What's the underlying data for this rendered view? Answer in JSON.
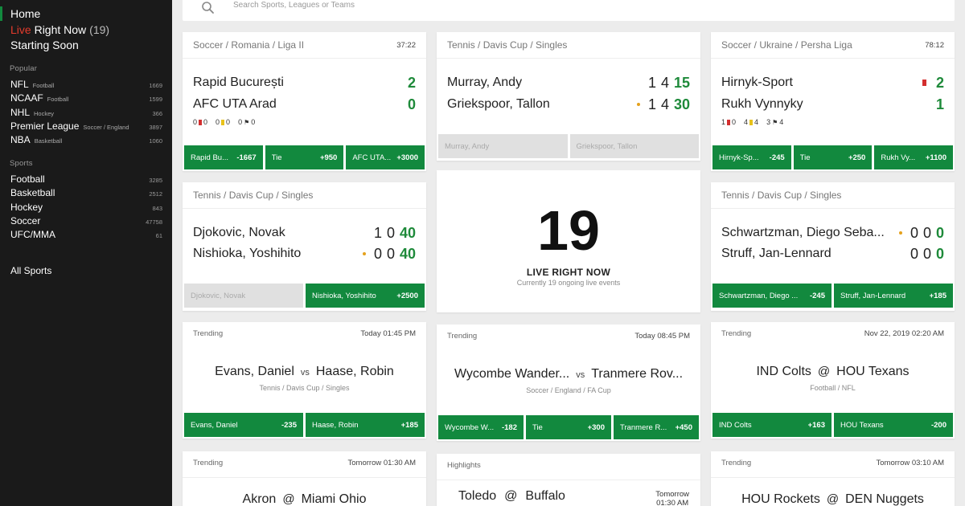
{
  "search": {
    "placeholder": "Search Sports, Leagues or Teams"
  },
  "nav": {
    "home": "Home",
    "live_prefix": "Live",
    "live_rest": "Right Now",
    "live_count": "(19)",
    "starting_soon": "Starting Soon",
    "popular_title": "Popular",
    "popular": [
      {
        "label": "NFL",
        "sub": "Football",
        "count": "1669"
      },
      {
        "label": "NCAAF",
        "sub": "Football",
        "count": "1599"
      },
      {
        "label": "NHL",
        "sub": "Hockey",
        "count": "366"
      },
      {
        "label": "Premier League",
        "sub": "Soccer / England",
        "count": "3897"
      },
      {
        "label": "NBA",
        "sub": "Basketball",
        "count": "1060"
      }
    ],
    "sports_title": "Sports",
    "sports": [
      {
        "label": "Football",
        "count": "3285"
      },
      {
        "label": "Basketball",
        "count": "2512"
      },
      {
        "label": "Hockey",
        "count": "843"
      },
      {
        "label": "Soccer",
        "count": "47758"
      },
      {
        "label": "UFC/MMA",
        "count": "61"
      }
    ],
    "all_sports": "All Sports"
  },
  "live_cards": {
    "c1": {
      "crumb": "Soccer / Romania / Liga II",
      "time": "37:22",
      "home": "Rapid București",
      "away": "AFC UTA Arad",
      "home_score": "2",
      "away_score": "0",
      "stats": {
        "red": "0",
        "red2": "0",
        "yellow": "0",
        "yellow2": "0",
        "corners": "0",
        "corners2": "0"
      },
      "btns": [
        {
          "label": "Rapid Bu...",
          "odds": "-1667"
        },
        {
          "label": "Tie",
          "odds": "+950"
        },
        {
          "label": "AFC UTA...",
          "odds": "+3000"
        }
      ]
    },
    "c2": {
      "crumb": "Tennis / Davis Cup / Singles",
      "home": "Murray, Andy",
      "away": "Griekspoor, Tallon",
      "home_s1": "1",
      "home_s2": "4",
      "home_s3": "15",
      "away_s1": "1",
      "away_s2": "4",
      "away_s3": "30",
      "btns": [
        {
          "label": "Murray, Andy"
        },
        {
          "label": "Griekspoor, Tallon"
        }
      ]
    },
    "c3": {
      "crumb": "Soccer / Ukraine / Persha Liga",
      "time": "78:12",
      "home": "Hirnyk-Sport",
      "away": "Rukh Vynnyky",
      "home_score": "2",
      "away_score": "1",
      "stats": {
        "red": "1",
        "red2": "0",
        "yellow": "4",
        "yellow2": "4",
        "corners": "3",
        "corners2": "4"
      },
      "btns": [
        {
          "label": "Hirnyk-Sp...",
          "odds": "-245"
        },
        {
          "label": "Tie",
          "odds": "+250"
        },
        {
          "label": "Rukh Vy...",
          "odds": "+1100"
        }
      ]
    },
    "c4": {
      "crumb": "Tennis / Davis Cup / Singles",
      "home": "Djokovic, Novak",
      "away": "Nishioka, Yoshihito",
      "home_s1": "1",
      "home_s2": "0",
      "home_s3": "40",
      "away_s1": "0",
      "away_s2": "0",
      "away_s3": "40",
      "btns": [
        {
          "label": "Djokovic, Novak"
        },
        {
          "label": "Nishioka, Yoshihito",
          "odds": "+2500"
        }
      ]
    },
    "c5": {
      "crumb": "Tennis / Davis Cup / Singles",
      "home": "Schwartzman, Diego Seba...",
      "away": "Struff, Jan-Lennard",
      "home_s1": "0",
      "home_s2": "0",
      "home_s3": "0",
      "away_s1": "0",
      "away_s2": "0",
      "away_s3": "0",
      "btns": [
        {
          "label": "Schwartzman, Diego ...",
          "odds": "-245"
        },
        {
          "label": "Struff, Jan-Lennard",
          "odds": "+185"
        }
      ]
    }
  },
  "live_summary": {
    "count": "19",
    "label": "LIVE RIGHT NOW",
    "sub": "Currently 19 ongoing live events"
  },
  "trend_cards": {
    "t1": {
      "tag": "Trending",
      "time": "Today 01:45 PM",
      "home": "Evans, Daniel",
      "sep": "vs",
      "away": "Haase, Robin",
      "sub": "Tennis / Davis Cup / Singles",
      "btns": [
        {
          "label": "Evans, Daniel",
          "odds": "-235"
        },
        {
          "label": "Haase, Robin",
          "odds": "+185"
        }
      ]
    },
    "t2": {
      "tag": "Trending",
      "time": "Today 08:45 PM",
      "home": "Wycombe Wander...",
      "sep": "vs",
      "away": "Tranmere Rov...",
      "sub": "Soccer / England / FA Cup",
      "btns": [
        {
          "label": "Wycombe W...",
          "odds": "-182"
        },
        {
          "label": "Tie",
          "odds": "+300"
        },
        {
          "label": "Tranmere R...",
          "odds": "+450"
        }
      ]
    },
    "t3": {
      "tag": "Trending",
      "time": "Nov 22, 2019 02:20 AM",
      "home": "IND Colts",
      "sep": "@",
      "away": "HOU Texans",
      "sub": "Football / NFL",
      "btns": [
        {
          "label": "IND Colts",
          "odds": "+163"
        },
        {
          "label": "HOU Texans",
          "odds": "-200"
        }
      ]
    },
    "t4": {
      "tag": "Trending",
      "time": "Tomorrow 01:30 AM",
      "home": "Akron",
      "sep": "@",
      "away": "Miami Ohio"
    },
    "t5": {
      "tag": "Highlights",
      "time1": "Tomorrow",
      "time2": "01:30 AM",
      "home": "Toledo",
      "sep": "@",
      "away": "Buffalo"
    },
    "t6": {
      "tag": "Trending",
      "time": "Tomorrow 03:10 AM",
      "home": "HOU Rockets",
      "sep": "@",
      "away": "DEN Nuggets"
    }
  }
}
